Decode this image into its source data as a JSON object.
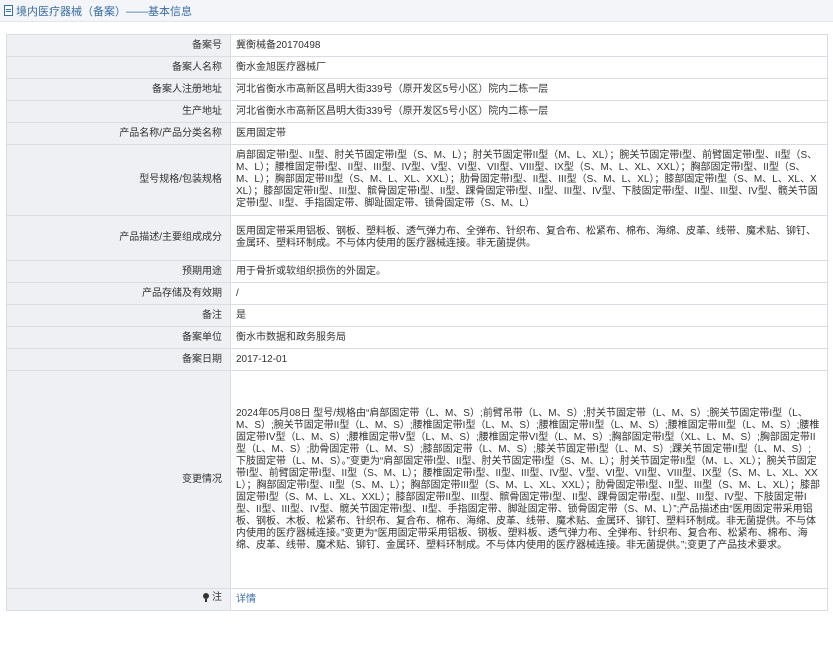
{
  "header": {
    "title": "境内医疗器械（备案）——基本信息"
  },
  "rows": [
    {
      "label": "备案号",
      "value": "冀衡械备20170498"
    },
    {
      "label": "备案人名称",
      "value": "衡水金旭医疗器械厂"
    },
    {
      "label": "备案人注册地址",
      "value": "河北省衡水市高新区昌明大街339号（原开发区5号小区）院内二栋一层"
    },
    {
      "label": "生产地址",
      "value": "河北省衡水市高新区昌明大街339号（原开发区5号小区）院内二栋一层"
    },
    {
      "label": "产品名称/产品分类名称",
      "value": "医用固定带"
    },
    {
      "label": "型号规格/包装规格",
      "value": "肩部固定带I型、II型、肘关节固定带I型（S、M、L）；肘关节固定带II型（M、L、XL）；腕关节固定带I型、前臂固定带I型、II型（S、M、L）；腰椎固定带I型、II型、III型、IV型、V型、VI型、VII型、VIII型、IX型（S、M、L、XL、XXL）；胸部固定带I型、II型（S、M、L）；胸部固定带III型（S、M、L、XL、XXL）；肋骨固定带I型、II型、III型（S、M、L、XL）；膝部固定带I型（S、M、L、XL、XXL）；膝部固定带II型、III型、髌骨固定带I型、II型、踝骨固定带I型、II型、III型、IV型、下肢固定带I型、II型、III型、IV型、髋关节固定带I型、II型、手指固定带、脚趾固定带、锁骨固定带（S、M、L）"
    },
    {
      "label": "产品描述/主要组成成分",
      "value": "医用固定带采用铝板、钢板、塑料板、透气弹力布、全弹布、针织布、复合布、松紧布、棉布、海绵、皮革、线带、魔术贴、铆钉、金属环、塑料环制成。不与体内使用的医疗器械连接。非无菌提供。"
    },
    {
      "label": "预期用途",
      "value": "用于骨折或软组织损伤的外固定。"
    },
    {
      "label": "产品存储及有效期",
      "value": "/"
    },
    {
      "label": "备注",
      "value": "是"
    },
    {
      "label": "备案单位",
      "value": "衡水市数据和政务服务局"
    },
    {
      "label": "备案日期",
      "value": "2017-12-01"
    },
    {
      "label": "变更情况",
      "value": "2024年05月08日 型号/规格由“肩部固定带（L、M、S）;前臂吊带（L、M、S）;肘关节固定带（L、M、S）;腕关节固定带I型（L、M、S）;腕关节固定带II型（L、M、S）;腰椎固定带I型（L、M、S）;腰椎固定带II型（L、M、S）;腰椎固定带III型（L、M、S）;腰椎固定带IV型（L、M、S）;腰椎固定带V型（L、M、S）;腰椎固定带VI型（L、M、S）;胸部固定带I型（XL、L、M、S）;胸部固定带II型（L、M、S）;肋骨固定带（L、M、S）;膝部固定带（L、M、S）;膝关节固定带I型（L、M、S）;踝关节固定带II型（L、M、S）;下肢固定带（L、M、S）。”变更为“肩部固定带I型、II型、肘关节固定带I型（S、M、L）；肘关节固定带II型（M、L、XL）；腕关节固定带I型、前臂固定带I型、II型（S、M、L）；腰椎固定带I型、II型、III型、IV型、V型、VI型、VII型、VIII型、IX型（S、M、L、XL、XXL）；胸部固定带I型、II型（S、M、L）；胸部固定带III型（S、M、L、XL、XXL）；肋骨固定带I型、II型、III型（S、M、L、XL）；膝部固定带I型（S、M、L、XL、XXL）；膝部固定带II型、III型、髌骨固定带I型、II型、踝骨固定带I型、II型、III型、IV型、下肢固定带I型、II型、III型、IV型、髋关节固定带I型、II型、手指固定带、脚趾固定带、锁骨固定带（S、M、L）”;产品描述由“医用固定带采用铝板、钢板、木板、松紧布、针织布、复合布、棉布、海绵、皮革、线带、魔术贴、金属环、铆钉、塑料环制成。非无菌提供。不与体内使用的医疗器械连接。”变更为“医用固定带采用铝板、钢板、塑料板、透气弹力布、全弹布、针织布、复合布、松紧布、棉布、海绵、皮革、线带、魔术贴、铆钉、金属环、塑料环制成。不与体内使用的医疗器械连接。非无菌提供。”;变更了产品技术要求。"
    }
  ],
  "note": {
    "label": "注",
    "link_text": "详情"
  }
}
